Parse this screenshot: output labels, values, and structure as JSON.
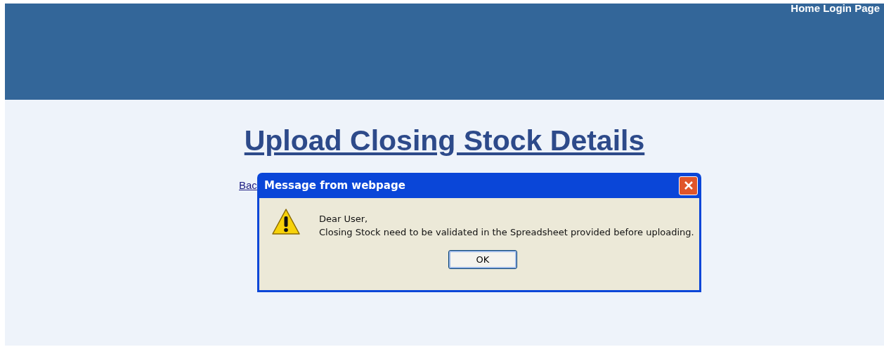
{
  "header": {
    "links": [
      "Home Login Page"
    ]
  },
  "page": {
    "title": "Upload Closing Stock Details",
    "back_link": "Bac"
  },
  "dialog": {
    "title": "Message from webpage",
    "lines": [
      "Dear User,",
      "Closing Stock need to be validated in the Spreadsheet provided before uploading."
    ],
    "button": "OK"
  }
}
